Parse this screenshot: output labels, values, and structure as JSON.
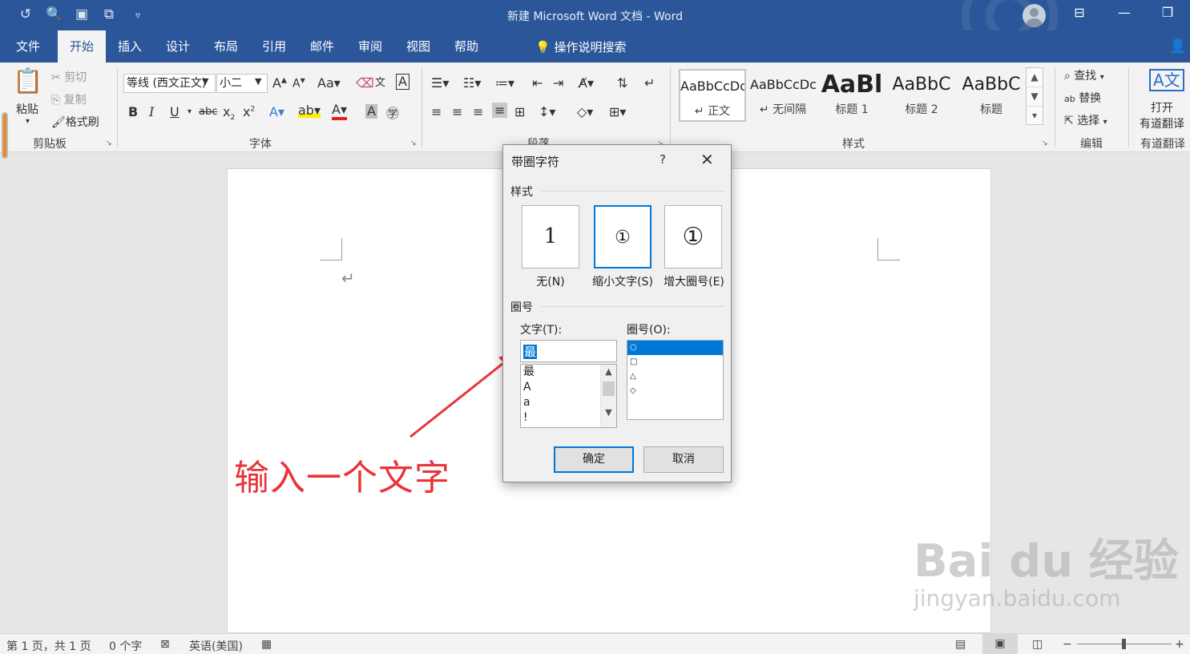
{
  "app": {
    "title": "新建 Microsoft Word 文档 - Word"
  },
  "quick_access": [
    "undo-icon",
    "print-preview-icon",
    "save-icon",
    "touch-mode-icon",
    "customize-icon"
  ],
  "tabs": [
    "文件",
    "开始",
    "插入",
    "设计",
    "布局",
    "引用",
    "邮件",
    "审阅",
    "视图",
    "帮助"
  ],
  "active_tab": "开始",
  "tell_me": "操作说明搜索",
  "ribbon": {
    "clipboard": {
      "paste": "粘贴",
      "cut": "剪切",
      "copy": "复制",
      "format_painter": "格式刷",
      "label": "剪贴板"
    },
    "font": {
      "font_name": "等线 (西文正文)",
      "font_size": "小二",
      "label": "字体"
    },
    "paragraph": {
      "label": "段落"
    },
    "styles": {
      "items": [
        {
          "preview": "AaBbCcDc",
          "name": "正文"
        },
        {
          "preview": "AaBbCcDc",
          "name": "无间隔"
        },
        {
          "preview": "AaBl",
          "name": "标题 1"
        },
        {
          "preview": "AaBbC",
          "name": "标题 2"
        },
        {
          "preview": "AaBbC",
          "name": "标题"
        }
      ],
      "label": "样式"
    },
    "editing": {
      "find": "查找",
      "replace": "替换",
      "select": "选择",
      "label": "编辑"
    },
    "youdao": {
      "open": "打开",
      "translate": "有道翻译",
      "label": "有道翻译"
    }
  },
  "dialog": {
    "title": "带圈字符",
    "help": "?",
    "style_section": "样式",
    "options": [
      {
        "glyph": "1",
        "label": "无(N)"
      },
      {
        "glyph": "①",
        "label": "缩小文字(S)"
      },
      {
        "glyph": "①",
        "label": "增大圈号(E)"
      }
    ],
    "selected_option": "缩小文字(S)",
    "enclosure_section": "圈号",
    "text_label": "文字(T):",
    "text_value": "最",
    "text_list": [
      "最",
      "A",
      "a",
      "!"
    ],
    "enclosure_label": "圈号(O):",
    "enclosure_list": [
      "○",
      "□",
      "△",
      "◇"
    ],
    "ok": "确定",
    "cancel": "取消"
  },
  "annotation": "输入一个文字",
  "status": {
    "page": "第 1 页，共 1 页",
    "words": "0 个字",
    "language": "英语(美国)"
  },
  "watermark": {
    "brand": "Bai du 经验",
    "url": "jingyan.baidu.com"
  }
}
